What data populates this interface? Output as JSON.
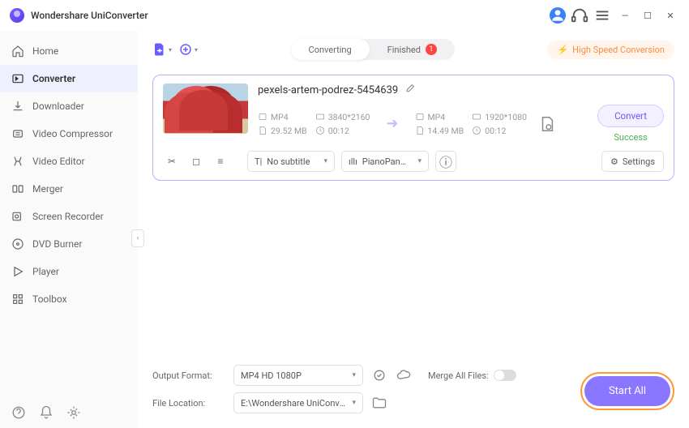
{
  "app": {
    "title": "Wondershare UniConverter"
  },
  "sidebar": {
    "items": [
      {
        "label": "Home",
        "icon": "home-icon"
      },
      {
        "label": "Converter",
        "icon": "converter-icon"
      },
      {
        "label": "Downloader",
        "icon": "downloader-icon"
      },
      {
        "label": "Video Compressor",
        "icon": "compressor-icon"
      },
      {
        "label": "Video Editor",
        "icon": "editor-icon"
      },
      {
        "label": "Merger",
        "icon": "merger-icon"
      },
      {
        "label": "Screen Recorder",
        "icon": "recorder-icon"
      },
      {
        "label": "DVD Burner",
        "icon": "dvd-icon"
      },
      {
        "label": "Player",
        "icon": "player-icon"
      },
      {
        "label": "Toolbox",
        "icon": "toolbox-icon"
      }
    ]
  },
  "tabs": {
    "converting": "Converting",
    "finished": "Finished",
    "finished_count": "1"
  },
  "highspeed": "High Speed Conversion",
  "file": {
    "name": "pexels-artem-podrez-5454639",
    "src": {
      "format": "MP4",
      "resolution": "3840*2160",
      "size": "29.52 MB",
      "duration": "00:12"
    },
    "dst": {
      "format": "MP4",
      "resolution": "1920*1080",
      "size": "14.49 MB",
      "duration": "00:12"
    },
    "subtitle": "No subtitle",
    "audio": "PianoPanda - ...",
    "convert": "Convert",
    "status": "Success",
    "settings": "Settings"
  },
  "footer": {
    "output_format_label": "Output Format:",
    "output_format": "MP4 HD 1080P",
    "file_location_label": "File Location:",
    "file_location": "E:\\Wondershare UniConverter",
    "merge_label": "Merge All Files:",
    "start_all": "Start All"
  }
}
